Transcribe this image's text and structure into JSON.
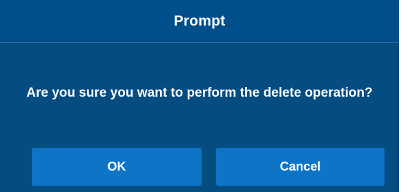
{
  "dialog": {
    "title": "Prompt",
    "message": "Are you sure you want to perform the delete operation?",
    "buttons": {
      "ok_label": "OK",
      "cancel_label": "Cancel"
    }
  },
  "colors": {
    "dialog_background": "#054c80",
    "header_background": "#004f8b",
    "button_background": "#0d74c6",
    "text": "#ffffff"
  }
}
